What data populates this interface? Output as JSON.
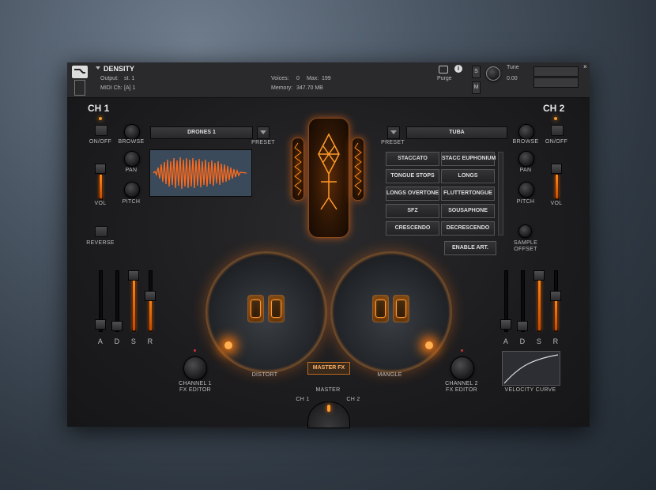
{
  "header": {
    "instrument_name": "DENSITY",
    "output_label": "Output:",
    "output_value": "st. 1",
    "voices_label": "Voices:",
    "voices_value": "0",
    "max_label": "Max:",
    "max_value": "199",
    "purge_label": "Purge",
    "midi_label": "MIDI Ch:",
    "midi_value": "[A] 1",
    "memory_label": "Memory:",
    "memory_value": "347.70 MB",
    "tune_label": "Tune",
    "tune_value": "0.00",
    "s_label": "S",
    "m_label": "M"
  },
  "ch1": {
    "title": "CH 1",
    "on_off": "ON/OFF",
    "browse": "BROWSE",
    "pan": "PAN",
    "pitch": "PITCH",
    "vol": "VOL",
    "reverse": "REVERSE",
    "preset_label": "PRESET",
    "preset_value": "DRONES 1",
    "adsr": [
      "A",
      "D",
      "S",
      "R"
    ],
    "fx_editor_line1": "CHANNEL 1",
    "fx_editor_line2": "FX EDITOR"
  },
  "ch2": {
    "title": "CH 2",
    "on_off": "ON/OFF",
    "browse": "BROWSE",
    "pan": "PAN",
    "pitch": "PITCH",
    "vol": "VOL",
    "sample_offset_line1": "SAMPLE",
    "sample_offset_line2": "OFFSET",
    "preset_label": "PRESET",
    "preset_value": "TUBA",
    "adsr": [
      "A",
      "D",
      "S",
      "R"
    ],
    "fx_editor_line1": "CHANNEL 2",
    "fx_editor_line2": "FX EDITOR",
    "velocity_curve": "VELOCITY CURVE"
  },
  "articulations": [
    "STACCATO",
    "STACC EUPHONIUM",
    "TONGUE STOPS",
    "LONGS",
    "LONGS OVERTONE",
    "FLUTTERTONGUE",
    "SFZ",
    "SOUSAPHONE",
    "CRESCENDO",
    "DECRESCENDO"
  ],
  "enable_art": "ENABLE ART.",
  "center": {
    "distort": "DISTORT",
    "mangle": "MANGLE",
    "master_fx": "MASTER FX",
    "master": "MASTER",
    "ch1": "CH 1",
    "ch2": "CH 2"
  },
  "colors": {
    "accent": "#ff8a1a",
    "panel": "#1b1b1d"
  }
}
